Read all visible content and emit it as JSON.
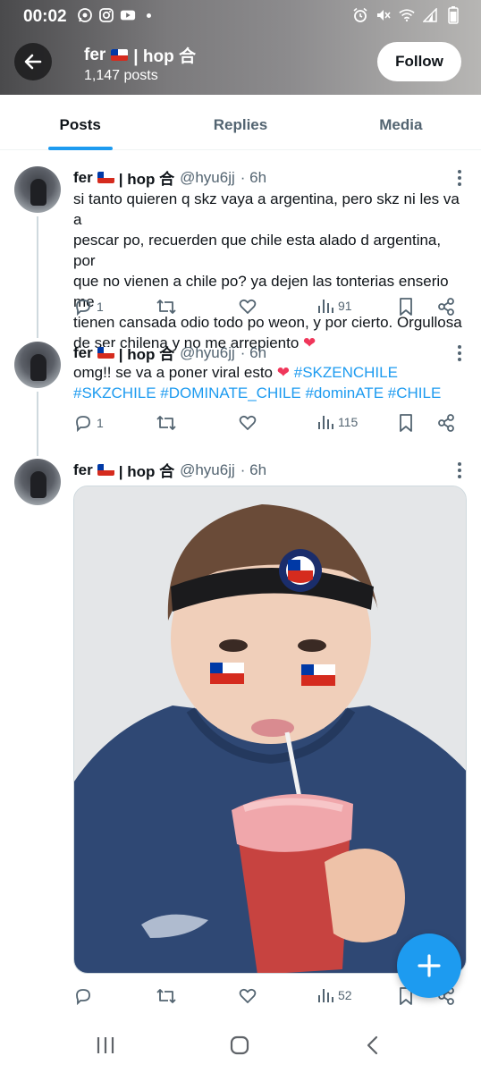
{
  "status": {
    "time": "00:02"
  },
  "header": {
    "name": "fer",
    "name_suffix": "| hop 合",
    "post_count": "1,147 posts",
    "follow_label": "Follow"
  },
  "tabs": [
    {
      "label": "Posts",
      "active": true
    },
    {
      "label": "Replies",
      "active": false
    },
    {
      "label": "Media",
      "active": false
    }
  ],
  "tweets": [
    {
      "name": "fer",
      "name_suffix": "| hop 合",
      "handle": "@hyu6jj",
      "time": "· 6h",
      "text_line1": "si tanto quieren q skz vaya a argentina, pero skz ni les va a",
      "text_line2": "pescar po, recuerden que chile esta alado d argentina, por",
      "text_line3": "que no vienen a chile po? ya dejen las tonterias enserio me",
      "text_line4": "tienen cansada odio todo po weon, y por cierto. Orgullosa",
      "text_line5": "de ser chilena y no me arrepiento",
      "replies": "1",
      "views": "91"
    },
    {
      "name": "fer",
      "name_suffix": "| hop 合",
      "handle": "@hyu6jj",
      "time": "· 6h",
      "text": "omg!! se va a poner viral esto",
      "hashtags_line1": "#SKZENCHILE",
      "hashtags_line2": "#SKZCHILE #DOMINATE_CHILE  #dominATE #CHILE",
      "replies": "1",
      "views": "115"
    },
    {
      "name": "fer",
      "name_suffix": "| hop 合",
      "handle": "@hyu6jj",
      "time": "· 6h",
      "views": "52"
    }
  ],
  "colors": {
    "accent": "#1d9bf0",
    "text": "#0f1419",
    "muted": "#536471",
    "heart": "#f0365a"
  }
}
